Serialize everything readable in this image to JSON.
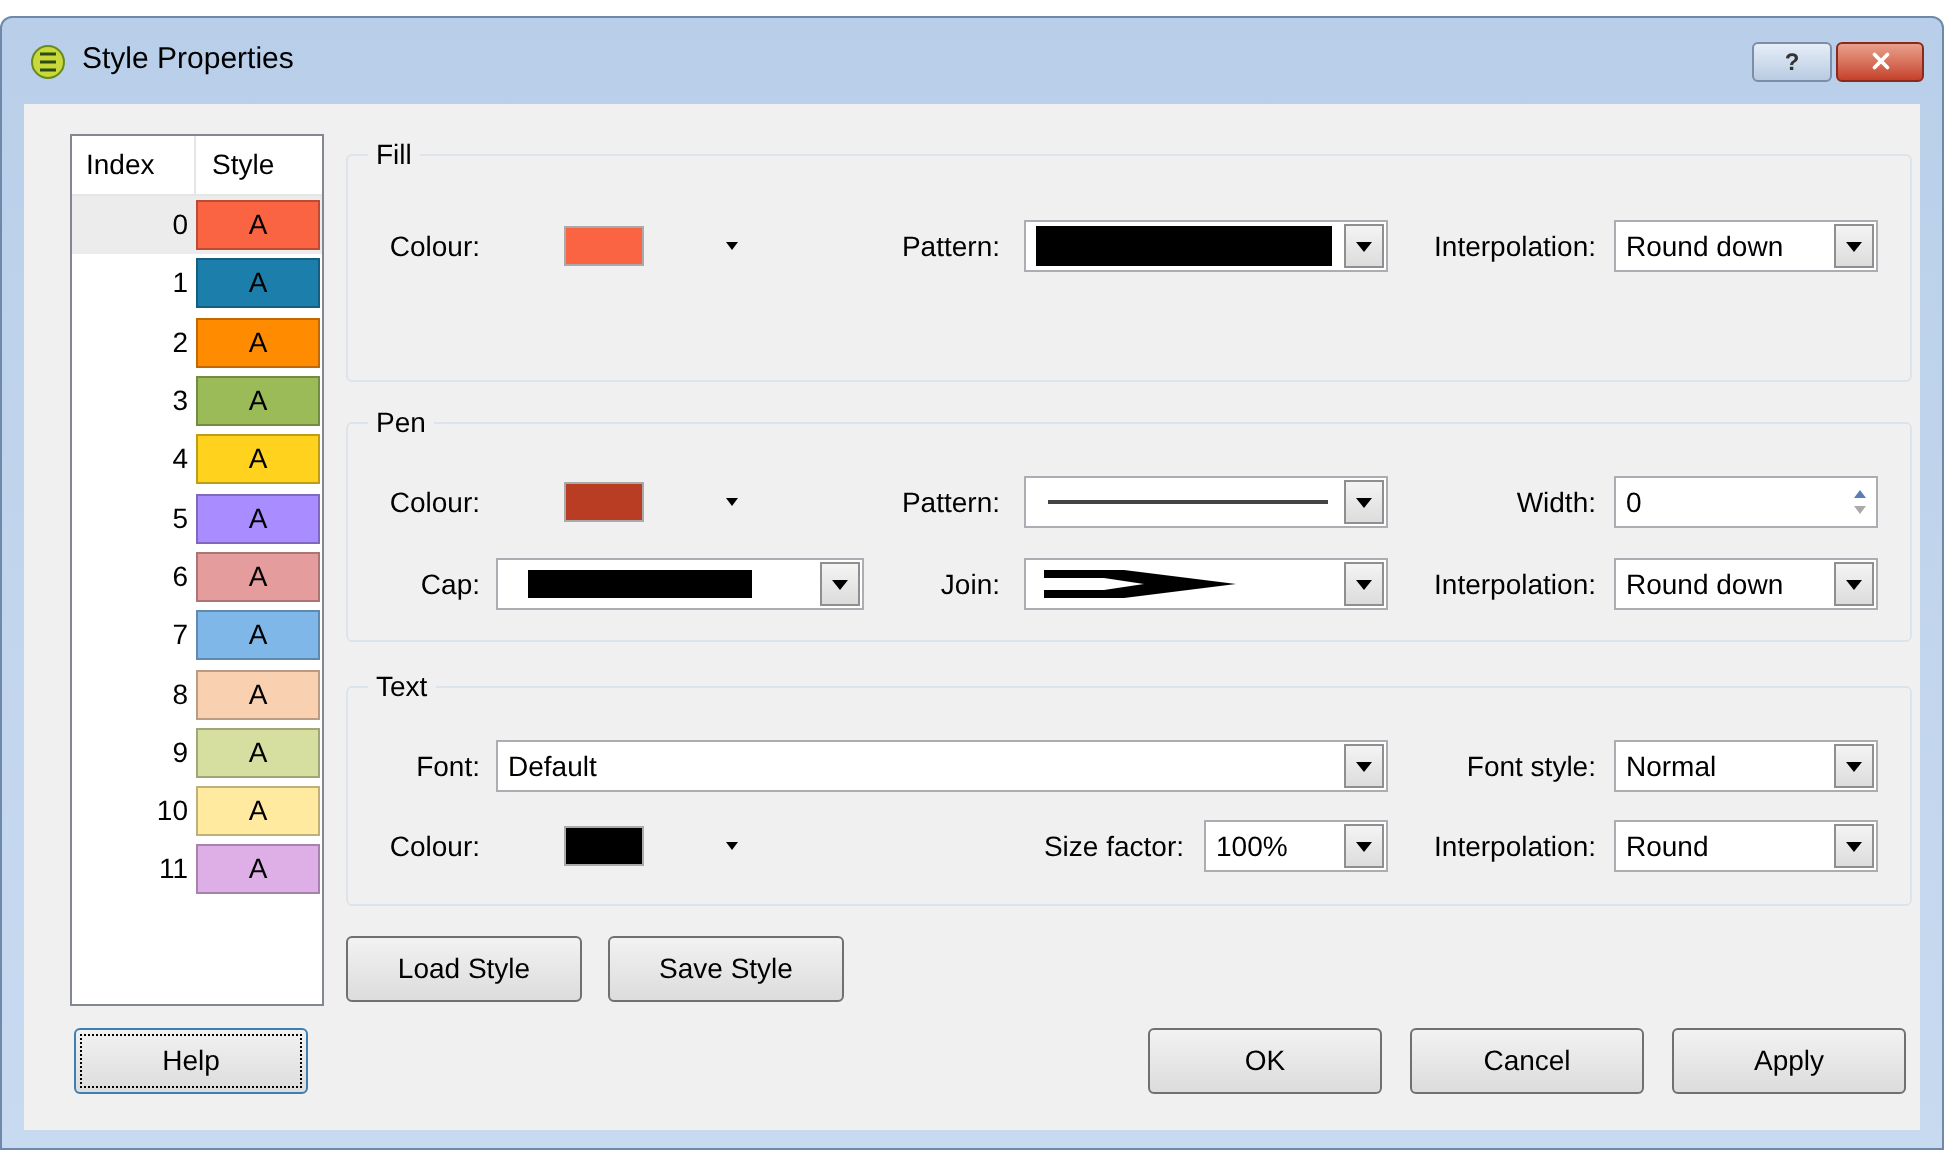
{
  "window": {
    "title": "Style Properties",
    "help_glyph": "?"
  },
  "styles": {
    "columns": [
      "Index",
      "Style"
    ],
    "rows": [
      {
        "index": "0",
        "sample": "A",
        "color": "#fb6443",
        "selected": true
      },
      {
        "index": "1",
        "sample": "A",
        "color": "#1b7eab",
        "selected": false
      },
      {
        "index": "2",
        "sample": "A",
        "color": "#ff8c00",
        "selected": false
      },
      {
        "index": "3",
        "sample": "A",
        "color": "#9bbb59",
        "selected": false
      },
      {
        "index": "4",
        "sample": "A",
        "color": "#ffd21e",
        "selected": false
      },
      {
        "index": "5",
        "sample": "A",
        "color": "#a98cff",
        "selected": false
      },
      {
        "index": "6",
        "sample": "A",
        "color": "#e59c9c",
        "selected": false
      },
      {
        "index": "7",
        "sample": "A",
        "color": "#7fb8e8",
        "selected": false
      },
      {
        "index": "8",
        "sample": "A",
        "color": "#f9d0b0",
        "selected": false
      },
      {
        "index": "9",
        "sample": "A",
        "color": "#d6dea0",
        "selected": false
      },
      {
        "index": "10",
        "sample": "A",
        "color": "#ffeaa0",
        "selected": false
      },
      {
        "index": "11",
        "sample": "A",
        "color": "#deaee6",
        "selected": false
      }
    ]
  },
  "fill": {
    "title": "Fill",
    "colour": {
      "label": "Colour:",
      "color": "#fb6443"
    },
    "pattern": {
      "label": "Pattern:",
      "kind": "solid"
    },
    "interpolation": {
      "label": "Interpolation:",
      "value": "Round down"
    }
  },
  "pen": {
    "title": "Pen",
    "colour": {
      "label": "Colour:",
      "color": "#b83d22"
    },
    "pattern": {
      "label": "Pattern:",
      "kind": "line"
    },
    "width": {
      "label": "Width:",
      "value": "0"
    },
    "cap": {
      "label": "Cap:",
      "kind": "bar"
    },
    "join": {
      "label": "Join:",
      "kind": "join"
    },
    "interpolation": {
      "label": "Interpolation:",
      "value": "Round down"
    }
  },
  "text": {
    "title": "Text",
    "font": {
      "label": "Font:",
      "value": "Default"
    },
    "font_style": {
      "label": "Font style:",
      "value": "Normal"
    },
    "colour": {
      "label": "Colour:",
      "color": "#000000"
    },
    "size_factor": {
      "label": "Size factor:",
      "value": "100%"
    },
    "interpolation": {
      "label": "Interpolation:",
      "value": "Round"
    }
  },
  "style_buttons": [
    "Load Style",
    "Save Style"
  ],
  "help_button": {
    "label": "Help",
    "focused": true
  },
  "dialog_buttons": [
    "OK",
    "Cancel",
    "Apply"
  ]
}
